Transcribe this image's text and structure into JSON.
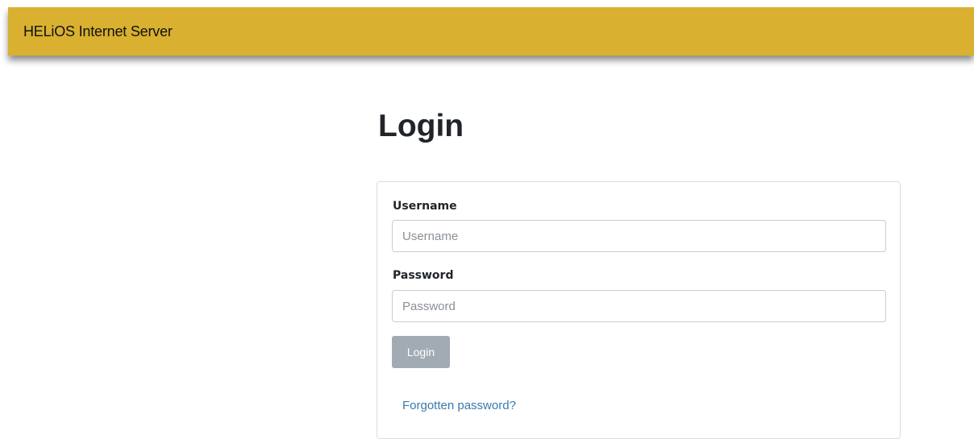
{
  "header": {
    "brand": "HELiOS Internet Server",
    "accent_color": "#d9b02f"
  },
  "page": {
    "title": "Login"
  },
  "form": {
    "username_label": "Username",
    "username_placeholder": "Username",
    "username_value": "",
    "password_label": "Password",
    "password_placeholder": "Password",
    "password_value": "",
    "login_button": "Login",
    "login_button_color": "#a2aab4",
    "forgot_link": "Forgotten password?",
    "link_color": "#3a79ad"
  }
}
